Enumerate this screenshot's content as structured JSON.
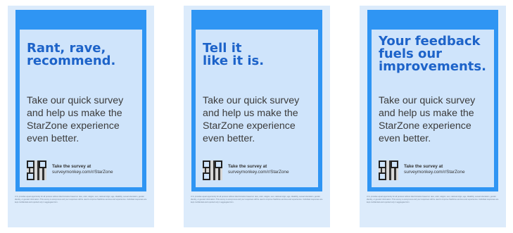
{
  "posters": [
    {
      "headline": "Rant, rave,\nrecommend.",
      "body": "Take our quick survey\nand help us make the\nStarZone experience\neven better.",
      "cta_label": "Take the survey at",
      "cta_url": "surveymonkey.com/r/StarZone",
      "fine_print": "U.S. provides equal opportunity for all persons without discrimination based on race, color, religion, sex, national origin, age, disability, sexual orientation, gender identity, or genetic information. This survey is anonymous and your responses will be used to improve StarZone services and experiences. Individual responses are kept confidential and reported only in aggregate form."
    },
    {
      "headline": "Tell it\nlike it is.",
      "body": "Take our quick survey\nand help us make the\nStarZone experience\neven better.",
      "cta_label": "Take the survey at",
      "cta_url": "surveymonkey.com/r/StarZone",
      "fine_print": "U.S. provides equal opportunity for all persons without discrimination based on race, color, religion, sex, national origin, age, disability, sexual orientation, gender identity, or genetic information. This survey is anonymous and your responses will be used to improve StarZone services and experiences. Individual responses are kept confidential and reported only in aggregate form."
    },
    {
      "headline": "Your feedback\nfuels our\nimprovements.",
      "body": "Take our quick survey\nand help us make the\nStarZone experience\neven better.",
      "cta_label": "Take the survey at",
      "cta_url": "surveymonkey.com/r/StarZone",
      "fine_print": "U.S. provides equal opportunity for all persons without discrimination based on race, color, religion, sex, national origin, age, disability, sexual orientation, gender identity, or genetic information. This survey is anonymous and your responses will be used to improve StarZone services and experiences. Individual responses are kept confidential and reported only in aggregate form."
    }
  ],
  "colors": {
    "frame": "#2f95f3",
    "panel": "#cfe4fb",
    "headline": "#1d63c9",
    "body": "#3b3b3b"
  }
}
